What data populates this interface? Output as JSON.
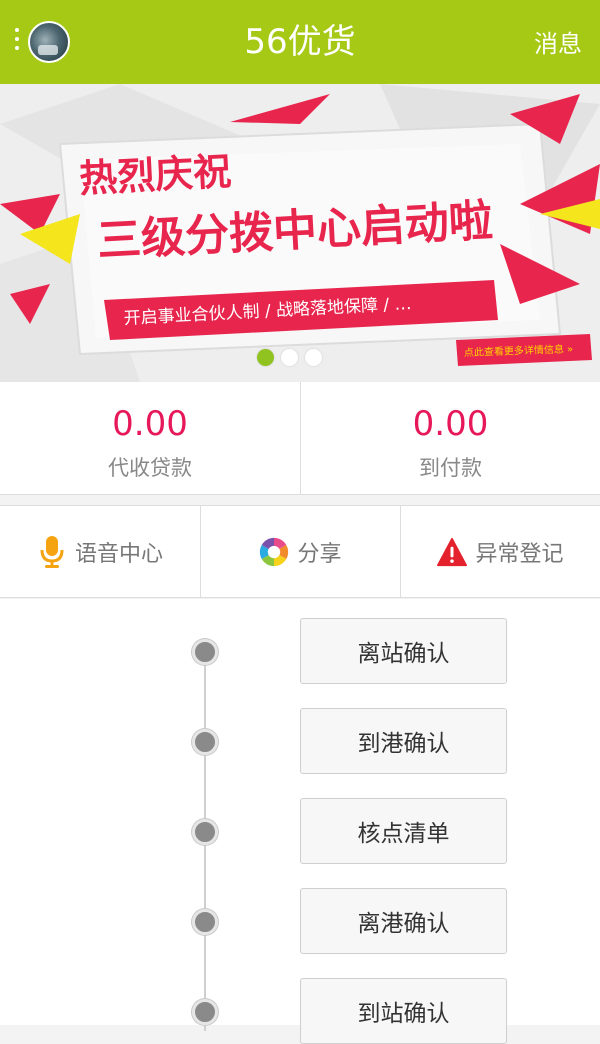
{
  "header": {
    "title": "56优货",
    "messages_label": "消息"
  },
  "banner": {
    "headline_1": "热烈庆祝",
    "headline_2": "三级分拨中心启动啦",
    "ribbon_text": "开启事业合伙人制 / 战略落地保障 / …",
    "cta_text": "点此查看更多详情信息 »",
    "slide_count": 3,
    "active_slide": 1,
    "accent_color": "#e8254d",
    "yellow_accent": "#f4e51c"
  },
  "amounts": {
    "cod": {
      "value": "0.00",
      "label": "代收贷款"
    },
    "freight_collect": {
      "value": "0.00",
      "label": "到付款"
    },
    "value_color": "#e6185a"
  },
  "actions": [
    {
      "label": "语音中心",
      "icon": "microphone-icon",
      "color": "#f5a311"
    },
    {
      "label": "分享",
      "icon": "share-pinwheel-icon",
      "color": "#e84c8b"
    },
    {
      "label": "异常登记",
      "icon": "warning-icon",
      "color": "#e4222e"
    }
  ],
  "timeline": [
    {
      "label": "离站确认"
    },
    {
      "label": "到港确认"
    },
    {
      "label": "核点清单"
    },
    {
      "label": "离港确认"
    },
    {
      "label": "到站确认"
    }
  ],
  "theme": {
    "header_color": "#a5c915"
  }
}
